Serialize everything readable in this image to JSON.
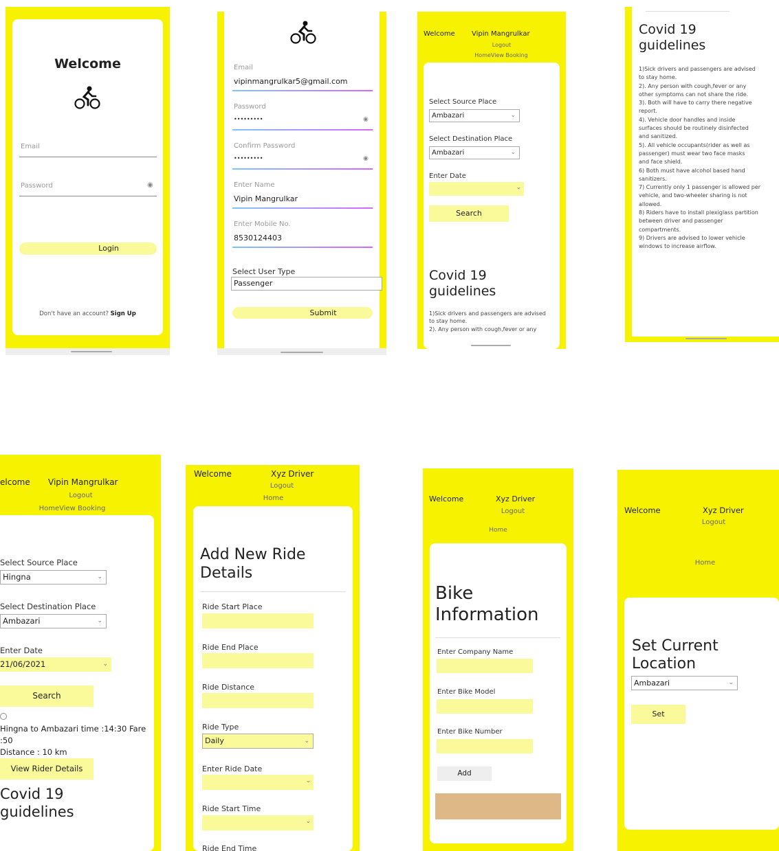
{
  "colors": {
    "brand_yellow": "#f7f300",
    "input_yellow": "#fbfa9a",
    "card": "#ffffff",
    "bike_box": "#deb887"
  },
  "icons": {
    "cyclist": "cyclist-icon",
    "eye": "eye-icon",
    "chevron": "chevron-down-icon"
  },
  "s1": {
    "title": "Welcome",
    "email_placeholder": "Email",
    "password_placeholder": "Password",
    "login": "Login",
    "signup_prompt": "Don't have an account?",
    "signup_link": "Sign Up"
  },
  "s2": {
    "email_label": "Email",
    "email_value": "vipinmangrulkar5@gmail.com",
    "password_label": "Password",
    "password_value": "•••••••••",
    "confirm_label": "Confirm Password",
    "confirm_value": "•••••••••",
    "name_label": "Enter Name",
    "name_value": "Vipin Mangrulkar",
    "mobile_label": "Enter Mobile No.",
    "mobile_value": "8530124403",
    "user_type_label": "Select User Type",
    "user_type_value": "Passenger",
    "submit": "Submit"
  },
  "s3": {
    "welcome": "Welcome",
    "user": "Vipin Mangrulkar",
    "logout": "Logout",
    "nav": "HomeView Booking",
    "source_label": "Select Source Place",
    "source_value": "Ambazari",
    "dest_label": "Select Destination Place",
    "dest_value": "Ambazari",
    "date_label": "Enter Date",
    "search": "Search",
    "covid_title_1": "Covid 19",
    "covid_title_2": "guidelines",
    "g1": "1)Sick drivers and passengers are advised",
    "g2": "to stay home.",
    "g3": "2). Any person with cough,fever or any"
  },
  "s4": {
    "title_1": "Covid 19",
    "title_2": "guidelines",
    "lines": [
      "1)Sick drivers and passengers are advised",
      "to stay home.",
      "2). Any person with cough,fever or any",
      "other symptoms can not share the ride.",
      "3). Both will have to carry there negative",
      "report.",
      "4). Vehicle door handles and inside",
      "surfaces should be routinely disinfected",
      "and sanitized.",
      "5). All vehicle occupants(rider as well as",
      "passenger) must wear two face masks",
      "and face shield.",
      "6) Both must have alcohol based hand",
      "sanitizers.",
      "7) Currently only 1 passenger is allowed per",
      "vehicle, and two-wheeler sharing is not",
      "allowed.",
      "8) Riders have to install plexiglass partition",
      "between driver and passenger",
      "compartments.",
      "9) Drivers are advised to lower vehicle",
      "windows to increase airflow."
    ]
  },
  "s5": {
    "welcome": "elcome",
    "user": "Vipin Mangrulkar",
    "logout": "Logout",
    "nav": "HomeView Booking",
    "source_label": "Select Source Place",
    "source_value": "Hingna",
    "dest_label": "Select Destination Place",
    "dest_value": "Ambazari",
    "date_label": "Enter Date",
    "date_value": "21/06/2021",
    "search": "Search",
    "result_1": "Hingna to Ambazari time :14:30 Fare :50",
    "result_2": "Distance : 10 km",
    "view_rider": "View Rider Details",
    "covid_title_1": "Covid 19",
    "covid_title_2": "guidelines"
  },
  "s6": {
    "welcome": "Welcome",
    "user": "Xyz Driver",
    "logout": "Logout",
    "home": "Home",
    "title_1": "Add New Ride",
    "title_2": "Details",
    "start_place": "Ride Start Place",
    "end_place": "Ride End Place",
    "distance": "Ride Distance",
    "type_label": "Ride Type",
    "type_value": "Daily",
    "date_label": "Enter Ride Date",
    "start_time": "Ride Start Time",
    "end_time": "Ride End Time"
  },
  "s7": {
    "welcome": "Welcome",
    "user": "Xyz Driver",
    "logout": "Logout",
    "home": "Home",
    "title_1": "Bike",
    "title_2": "Information",
    "company": "Enter Company Name",
    "model": "Enter Bike Model",
    "number": "Enter Bike Number",
    "add": "Add"
  },
  "s8": {
    "welcome": "Welcome",
    "user": "Xyz Driver",
    "logout": "Logout",
    "home": "Home",
    "title_1": "Set Current",
    "title_2": "Location",
    "location_value": "Ambazari",
    "set": "Set"
  }
}
